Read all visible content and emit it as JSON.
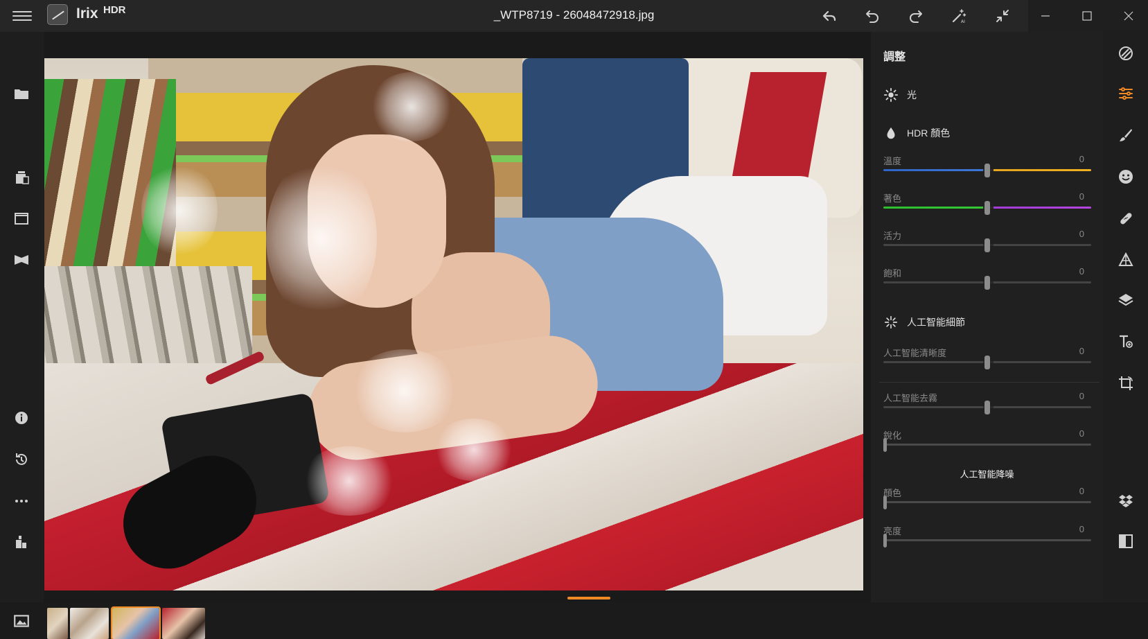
{
  "titlebar": {
    "app_name": "Irix",
    "app_sub": "HDR",
    "file_title": "_WTP8719 - 26048472918.jpg",
    "buttons": [
      "back-icon",
      "undo-icon",
      "redo-icon",
      "magic-wand-ai-icon",
      "collapse-icon"
    ],
    "window_controls": [
      "minimize-icon",
      "maximize-icon",
      "close-icon"
    ]
  },
  "left_toolbar": [
    "folder-icon",
    "batch-icon",
    "window-icon",
    "compare-icon",
    "info-icon",
    "history-icon",
    "more-icon",
    "plugin-icon"
  ],
  "panel": {
    "title": "調整",
    "light_section": "光",
    "hdr_color_section": "HDR 顏色",
    "temperature": {
      "label": "溫度",
      "value": "0"
    },
    "tint": {
      "label": "著色",
      "value": "0"
    },
    "vibrance": {
      "label": "活力",
      "value": "0"
    },
    "saturation": {
      "label": "飽和",
      "value": "0"
    },
    "ai_detail_section": "人工智能細節",
    "ai_clarity": {
      "label": "人工智能清晰度",
      "value": "0"
    },
    "ai_dehaze": {
      "label": "人工智能去霧",
      "value": "0"
    },
    "sharpen": {
      "label": "銳化",
      "value": "0"
    },
    "ai_denoise_title": "人工智能降噪",
    "denoise_color": {
      "label": "顏色",
      "value": "0"
    },
    "denoise_luminance": {
      "label": "亮度",
      "value": "0"
    }
  },
  "right_toolbar": [
    "presets-icon",
    "adjust-sliders-icon",
    "brush-icon",
    "face-icon",
    "heal-icon",
    "shapes-icon",
    "layers-icon",
    "text-icon",
    "crop-icon",
    "dropbox-icon",
    "split-view-icon"
  ],
  "colors": {
    "accent": "#f08a24",
    "temp_cool": "#3d77d6",
    "temp_warm": "#f0b020",
    "tint_green": "#35c835",
    "tint_magenta": "#b545e0"
  },
  "filmstrip": {
    "icon": "image-icon",
    "thumbnails": 4,
    "selected_index": 2
  }
}
